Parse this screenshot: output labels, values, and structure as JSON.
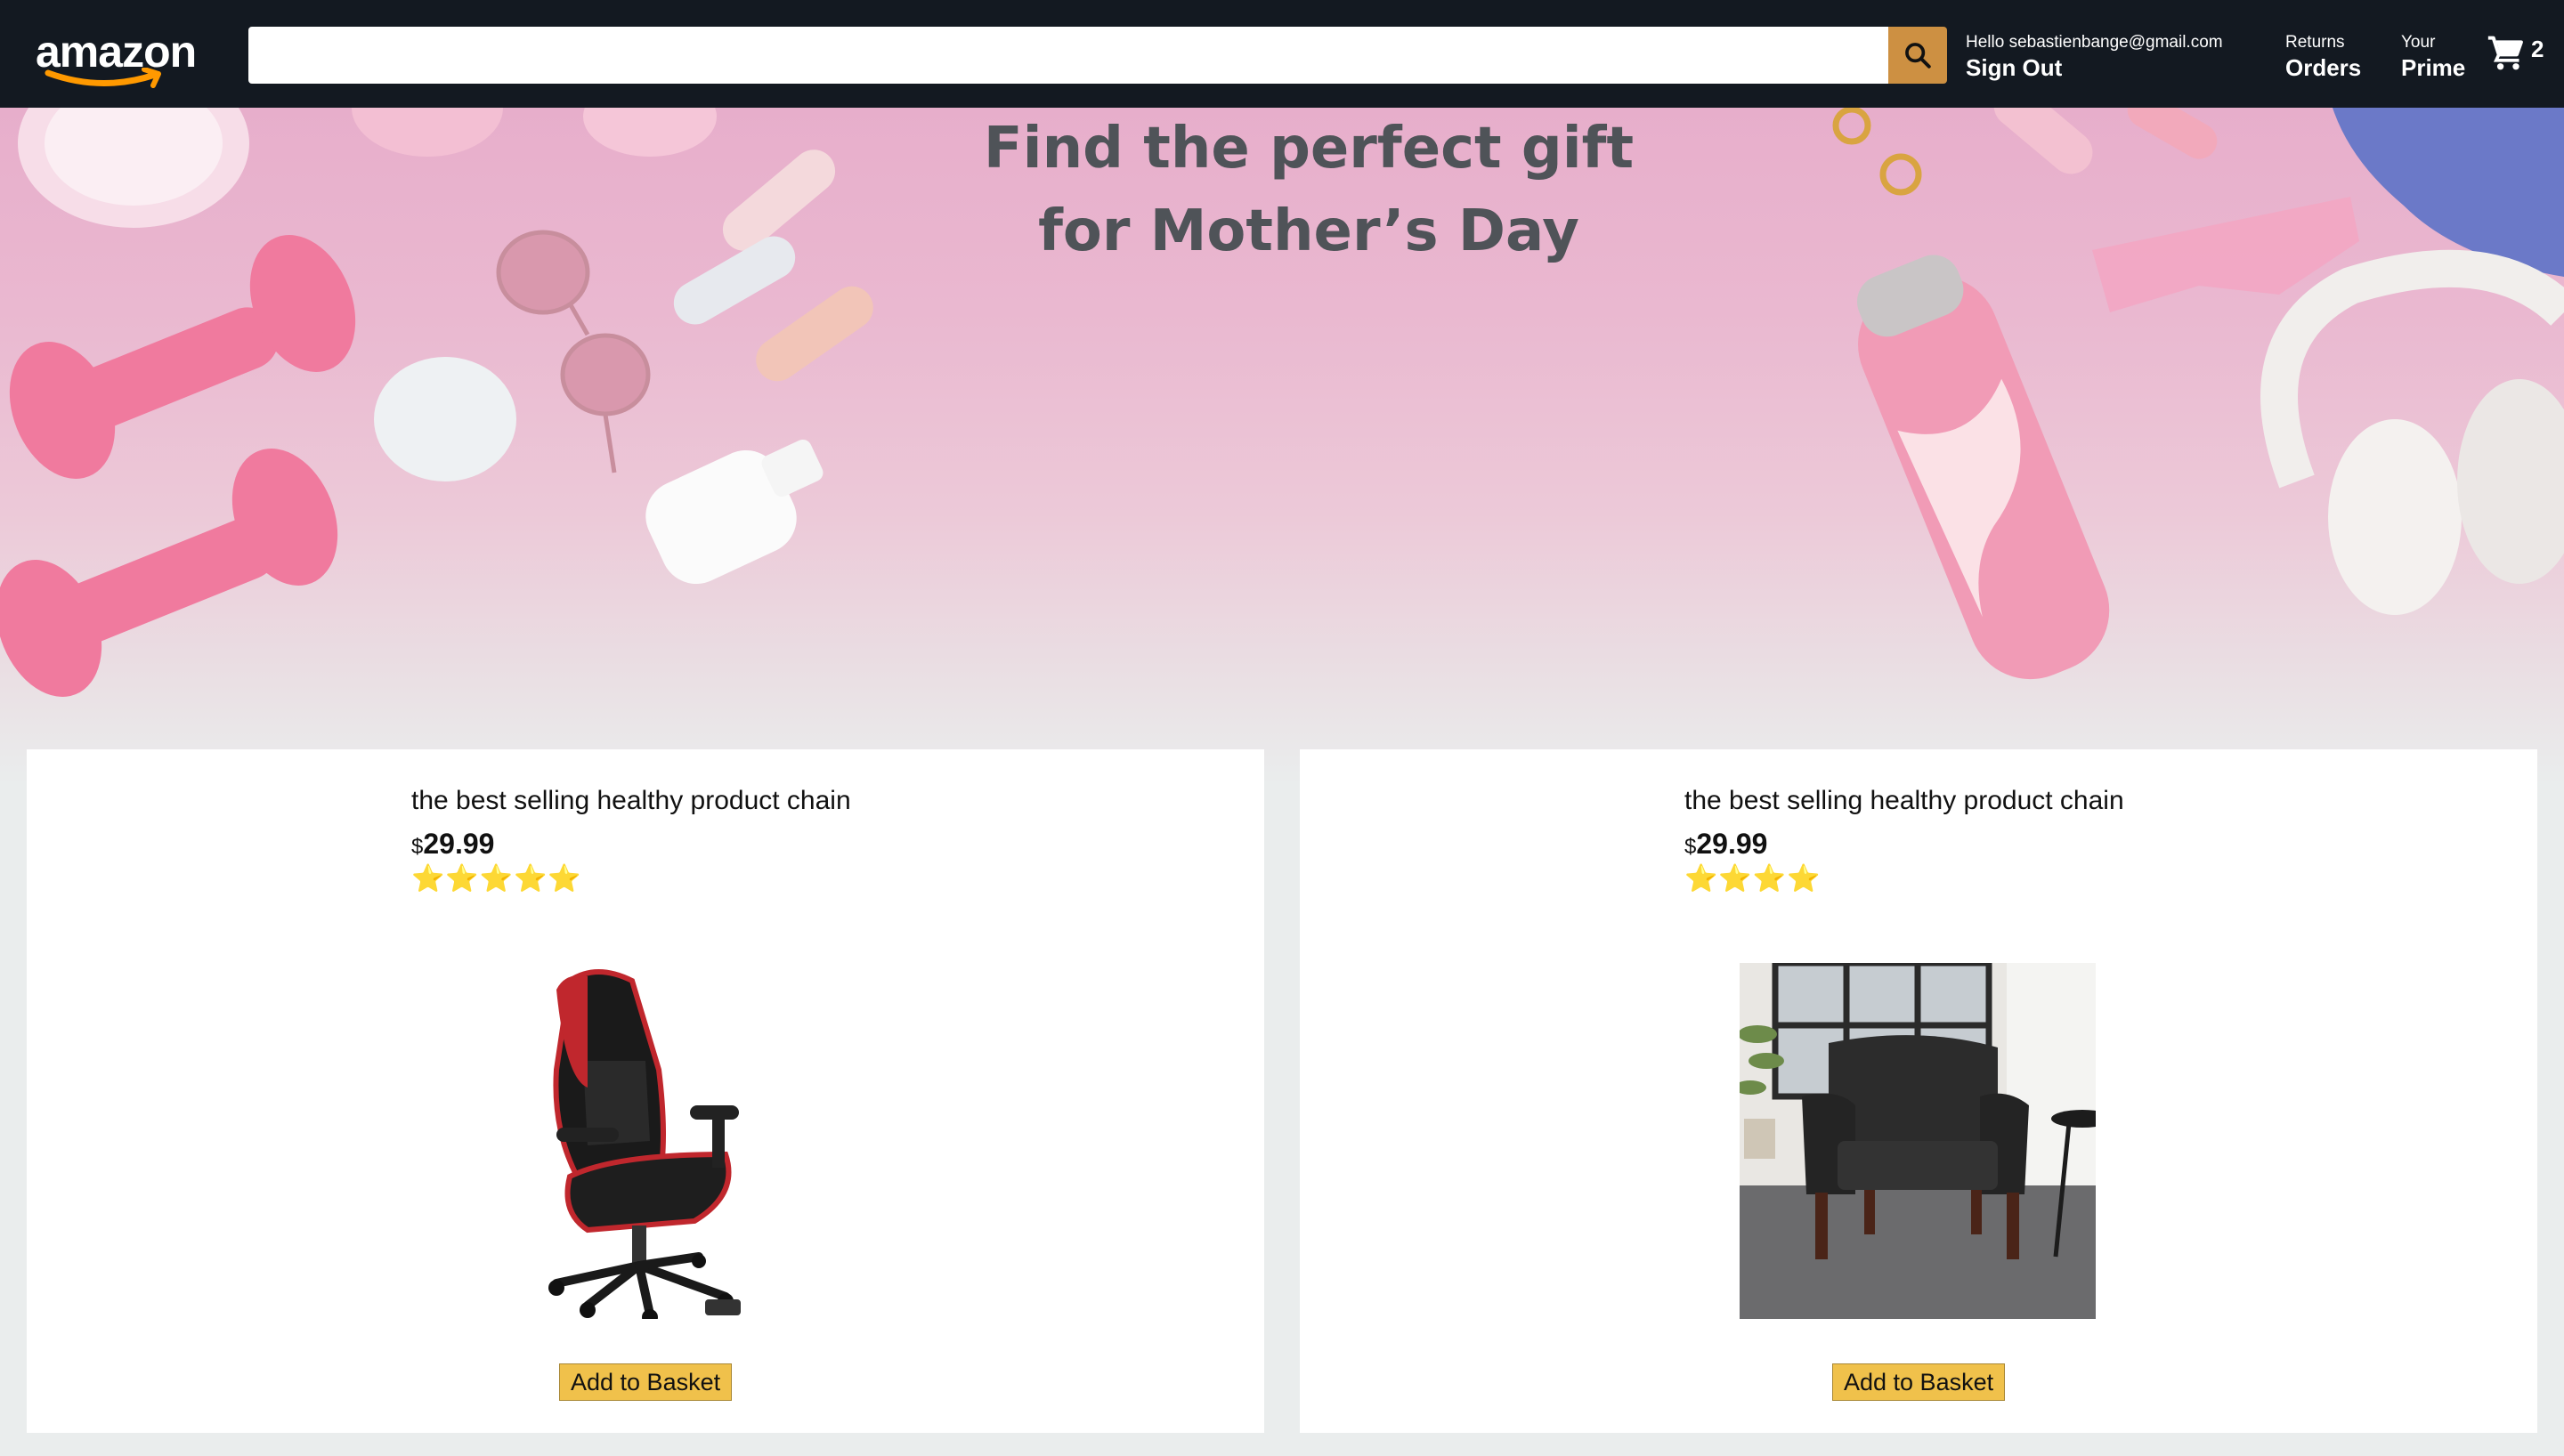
{
  "header": {
    "logo_text": "amazon",
    "search": {
      "value": "",
      "placeholder": ""
    },
    "user": {
      "greeting": "Hello sebastienbange@gmail.com",
      "action": "Sign Out"
    },
    "orders": {
      "line1": "Returns",
      "line2": "Orders"
    },
    "prime": {
      "line1": "Your",
      "line2": "Prime"
    },
    "basket": {
      "count": "2"
    },
    "colors": {
      "background": "#131921",
      "search_button": "#cd9042"
    }
  },
  "hero": {
    "title_line1": "Find the perfect gift",
    "title_line2": "for Mother’s Day"
  },
  "products": [
    {
      "title": "the best selling healthy product chain",
      "currency": "$",
      "price": "29.99",
      "rating_stars": "⭐⭐⭐⭐⭐",
      "rating": 5,
      "image": "gaming-chair-image",
      "button_label": "Add to Basket"
    },
    {
      "title": "the best selling healthy product chain",
      "currency": "$",
      "price": "29.99",
      "rating_stars": "⭐⭐⭐⭐",
      "rating": 4,
      "image": "armchair-image",
      "button_label": "Add to Basket"
    }
  ]
}
